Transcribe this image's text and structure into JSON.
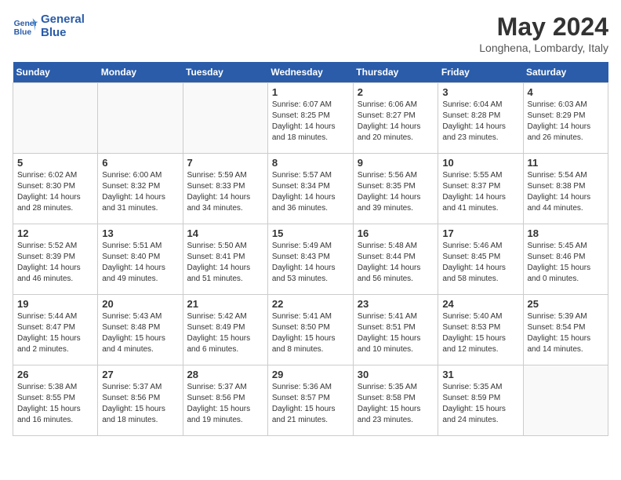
{
  "logo": {
    "line1": "General",
    "line2": "Blue"
  },
  "title": "May 2024",
  "location": "Longhena, Lombardy, Italy",
  "days_header": [
    "Sunday",
    "Monday",
    "Tuesday",
    "Wednesday",
    "Thursday",
    "Friday",
    "Saturday"
  ],
  "weeks": [
    [
      {
        "num": "",
        "info": ""
      },
      {
        "num": "",
        "info": ""
      },
      {
        "num": "",
        "info": ""
      },
      {
        "num": "1",
        "info": "Sunrise: 6:07 AM\nSunset: 8:25 PM\nDaylight: 14 hours\nand 18 minutes."
      },
      {
        "num": "2",
        "info": "Sunrise: 6:06 AM\nSunset: 8:27 PM\nDaylight: 14 hours\nand 20 minutes."
      },
      {
        "num": "3",
        "info": "Sunrise: 6:04 AM\nSunset: 8:28 PM\nDaylight: 14 hours\nand 23 minutes."
      },
      {
        "num": "4",
        "info": "Sunrise: 6:03 AM\nSunset: 8:29 PM\nDaylight: 14 hours\nand 26 minutes."
      }
    ],
    [
      {
        "num": "5",
        "info": "Sunrise: 6:02 AM\nSunset: 8:30 PM\nDaylight: 14 hours\nand 28 minutes."
      },
      {
        "num": "6",
        "info": "Sunrise: 6:00 AM\nSunset: 8:32 PM\nDaylight: 14 hours\nand 31 minutes."
      },
      {
        "num": "7",
        "info": "Sunrise: 5:59 AM\nSunset: 8:33 PM\nDaylight: 14 hours\nand 34 minutes."
      },
      {
        "num": "8",
        "info": "Sunrise: 5:57 AM\nSunset: 8:34 PM\nDaylight: 14 hours\nand 36 minutes."
      },
      {
        "num": "9",
        "info": "Sunrise: 5:56 AM\nSunset: 8:35 PM\nDaylight: 14 hours\nand 39 minutes."
      },
      {
        "num": "10",
        "info": "Sunrise: 5:55 AM\nSunset: 8:37 PM\nDaylight: 14 hours\nand 41 minutes."
      },
      {
        "num": "11",
        "info": "Sunrise: 5:54 AM\nSunset: 8:38 PM\nDaylight: 14 hours\nand 44 minutes."
      }
    ],
    [
      {
        "num": "12",
        "info": "Sunrise: 5:52 AM\nSunset: 8:39 PM\nDaylight: 14 hours\nand 46 minutes."
      },
      {
        "num": "13",
        "info": "Sunrise: 5:51 AM\nSunset: 8:40 PM\nDaylight: 14 hours\nand 49 minutes."
      },
      {
        "num": "14",
        "info": "Sunrise: 5:50 AM\nSunset: 8:41 PM\nDaylight: 14 hours\nand 51 minutes."
      },
      {
        "num": "15",
        "info": "Sunrise: 5:49 AM\nSunset: 8:43 PM\nDaylight: 14 hours\nand 53 minutes."
      },
      {
        "num": "16",
        "info": "Sunrise: 5:48 AM\nSunset: 8:44 PM\nDaylight: 14 hours\nand 56 minutes."
      },
      {
        "num": "17",
        "info": "Sunrise: 5:46 AM\nSunset: 8:45 PM\nDaylight: 14 hours\nand 58 minutes."
      },
      {
        "num": "18",
        "info": "Sunrise: 5:45 AM\nSunset: 8:46 PM\nDaylight: 15 hours\nand 0 minutes."
      }
    ],
    [
      {
        "num": "19",
        "info": "Sunrise: 5:44 AM\nSunset: 8:47 PM\nDaylight: 15 hours\nand 2 minutes."
      },
      {
        "num": "20",
        "info": "Sunrise: 5:43 AM\nSunset: 8:48 PM\nDaylight: 15 hours\nand 4 minutes."
      },
      {
        "num": "21",
        "info": "Sunrise: 5:42 AM\nSunset: 8:49 PM\nDaylight: 15 hours\nand 6 minutes."
      },
      {
        "num": "22",
        "info": "Sunrise: 5:41 AM\nSunset: 8:50 PM\nDaylight: 15 hours\nand 8 minutes."
      },
      {
        "num": "23",
        "info": "Sunrise: 5:41 AM\nSunset: 8:51 PM\nDaylight: 15 hours\nand 10 minutes."
      },
      {
        "num": "24",
        "info": "Sunrise: 5:40 AM\nSunset: 8:53 PM\nDaylight: 15 hours\nand 12 minutes."
      },
      {
        "num": "25",
        "info": "Sunrise: 5:39 AM\nSunset: 8:54 PM\nDaylight: 15 hours\nand 14 minutes."
      }
    ],
    [
      {
        "num": "26",
        "info": "Sunrise: 5:38 AM\nSunset: 8:55 PM\nDaylight: 15 hours\nand 16 minutes."
      },
      {
        "num": "27",
        "info": "Sunrise: 5:37 AM\nSunset: 8:56 PM\nDaylight: 15 hours\nand 18 minutes."
      },
      {
        "num": "28",
        "info": "Sunrise: 5:37 AM\nSunset: 8:56 PM\nDaylight: 15 hours\nand 19 minutes."
      },
      {
        "num": "29",
        "info": "Sunrise: 5:36 AM\nSunset: 8:57 PM\nDaylight: 15 hours\nand 21 minutes."
      },
      {
        "num": "30",
        "info": "Sunrise: 5:35 AM\nSunset: 8:58 PM\nDaylight: 15 hours\nand 23 minutes."
      },
      {
        "num": "31",
        "info": "Sunrise: 5:35 AM\nSunset: 8:59 PM\nDaylight: 15 hours\nand 24 minutes."
      },
      {
        "num": "",
        "info": ""
      }
    ]
  ]
}
